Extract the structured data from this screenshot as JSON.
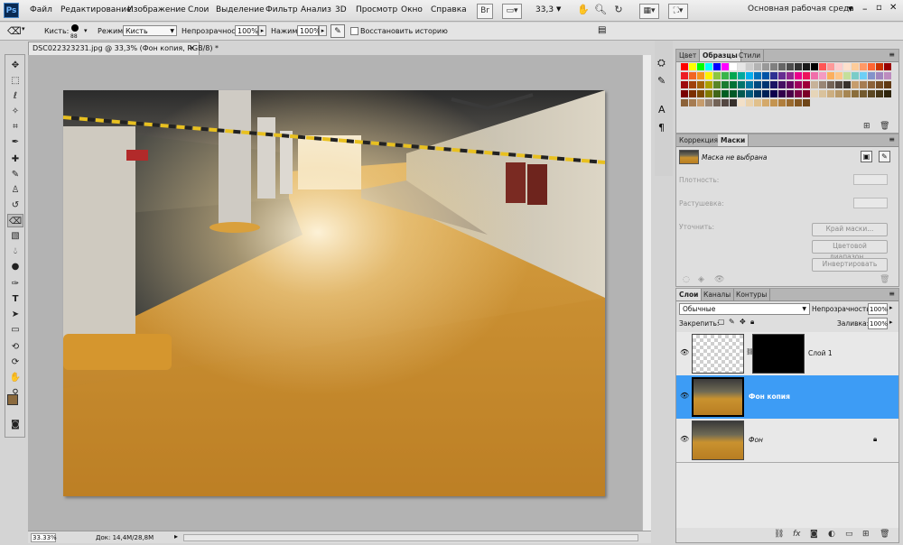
{
  "app": {
    "logo": "Ps"
  },
  "menu": [
    "Файл",
    "Редактирование",
    "Изображение",
    "Слои",
    "Выделение",
    "Фильтр",
    "Анализ",
    "3D",
    "Просмотр",
    "Окно",
    "Справка"
  ],
  "appbar": {
    "zoom": "33,3",
    "workspace": "Основная рабочая среда"
  },
  "options": {
    "brush_label": "Кисть:",
    "brush_size": "88",
    "mode_label": "Режим:",
    "mode_value": "Кисть",
    "opacity_label": "Непрозрачность:",
    "opacity_value": "100%",
    "pressure_label": "Нажим:",
    "pressure_value": "100%",
    "history_label": "Восстановить историю"
  },
  "document": {
    "tab_title": "DSC022323231.jpg @ 33,3% (Фон копия, RGB/8) *",
    "status_zoom": "33.33%",
    "status_doc": "Док: 14,4M/28,8M"
  },
  "swatches_panel": {
    "tabs": [
      "Цвет",
      "Образцы",
      "Стили"
    ],
    "active_tab": "Образцы",
    "rows": [
      [
        "#ff0000",
        "#ffff00",
        "#00ff00",
        "#00ffff",
        "#0000ff",
        "#ff00ff",
        "#ffffff",
        "#e6e6e6",
        "#cccccc",
        "#b3b3b3",
        "#999999",
        "#808080",
        "#666666",
        "#4d4d4d",
        "#333333",
        "#1a1a1a",
        "#000000",
        "#ff5555",
        "#ff9999",
        "#ffcccc",
        "#ffe0cc",
        "#ffcc99",
        "#ff9966",
        "#ff6633",
        "#cc3300",
        "#990000"
      ],
      [
        "#ed1c24",
        "#f26522",
        "#f7941d",
        "#fff200",
        "#8dc63f",
        "#39b54a",
        "#00a651",
        "#00a99d",
        "#00aeef",
        "#0072bc",
        "#0054a6",
        "#2e3192",
        "#662d91",
        "#92278f",
        "#ec008c",
        "#ed145b",
        "#f06eaa",
        "#f49ac2",
        "#fbaf5d",
        "#fdc689",
        "#c4df9b",
        "#7accc8",
        "#6dcff6",
        "#8393ca",
        "#a186be",
        "#bd8cbf"
      ],
      [
        "#9e0b0f",
        "#a0410d",
        "#a36209",
        "#aba000",
        "#598527",
        "#1a7b30",
        "#007236",
        "#00746b",
        "#0076a3",
        "#004a80",
        "#003471",
        "#1b1464",
        "#440e62",
        "#630460",
        "#9e005d",
        "#9e0039",
        "#c7b299",
        "#998675",
        "#736357",
        "#534741",
        "#37302c",
        "#c69c6d",
        "#a67c52",
        "#8c6239",
        "#754c24",
        "#603913"
      ],
      [
        "#790000",
        "#7b2e00",
        "#7d4900",
        "#827b00",
        "#406618",
        "#005e20",
        "#005826",
        "#005952",
        "#005b7f",
        "#003663",
        "#002157",
        "#0d004c",
        "#32004b",
        "#4b0049",
        "#7b0046",
        "#7a0026",
        "#e6d5b8",
        "#d9c29c",
        "#ccae80",
        "#b99a6a",
        "#a68653",
        "#8a6d3b",
        "#735a2f",
        "#5c4823",
        "#453617",
        "#2e240b"
      ],
      [
        "#8c6239",
        "#a67c52",
        "#c69c6d",
        "#998675",
        "#736357",
        "#534741",
        "#37302c",
        "#f2e0c8",
        "#ead2ac",
        "#e0c08c",
        "#d4a96a",
        "#c49450",
        "#b07e3c",
        "#9a6a2e",
        "#845722",
        "#6e4518"
      ]
    ]
  },
  "adjustments_panel": {
    "tabs": [
      "Коррекция",
      "Маски"
    ],
    "active_tab": "Маски",
    "mask_status": "Маска не выбрана",
    "density_label": "Плотность:",
    "feather_label": "Растушевка:",
    "refine_label": "Уточнить:",
    "buttons": [
      "Край маски...",
      "Цветовой диапазон...",
      "Инвертировать"
    ]
  },
  "layers_panel": {
    "tabs": [
      "Слои",
      "Каналы",
      "Контуры"
    ],
    "active_tab": "Слои",
    "blend_mode": "Обычные",
    "opacity_label": "Непрозрачность:",
    "opacity_value": "100%",
    "lock_label": "Закрепить:",
    "fill_label": "Заливка:",
    "fill_value": "100%",
    "layers": [
      {
        "name": "Слой 1",
        "selected": false,
        "has_mask": true
      },
      {
        "name": "Фон копия",
        "selected": true,
        "has_mask": false
      },
      {
        "name": "Фон",
        "selected": false,
        "has_mask": false
      }
    ]
  },
  "colors": {
    "foreground": "#8b6a3e",
    "background": "#d8c29a",
    "selection": "#3d9cf5"
  }
}
